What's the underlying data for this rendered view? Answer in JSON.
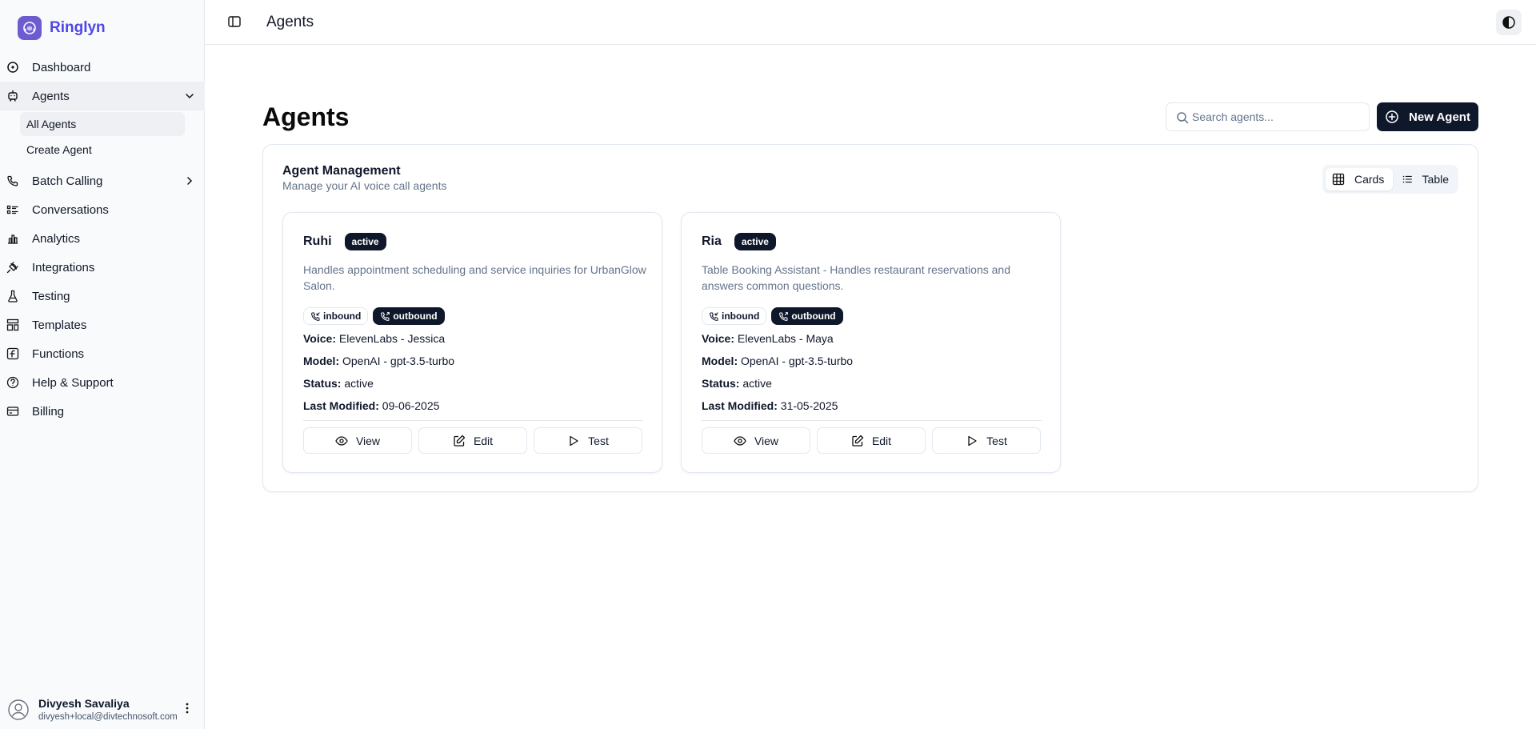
{
  "app": {
    "name": "Ringlyn"
  },
  "sidebar": {
    "items": [
      {
        "label": "Dashboard"
      },
      {
        "label": "Agents"
      },
      {
        "label": "Batch Calling"
      },
      {
        "label": "Conversations"
      },
      {
        "label": "Analytics"
      },
      {
        "label": "Integrations"
      },
      {
        "label": "Testing"
      },
      {
        "label": "Templates"
      },
      {
        "label": "Functions"
      },
      {
        "label": "Help & Support"
      },
      {
        "label": "Billing"
      }
    ],
    "agents_sub": [
      {
        "label": "All Agents"
      },
      {
        "label": "Create Agent"
      }
    ],
    "user": {
      "name": "Divyesh Savaliya",
      "email": "divyesh+local@divtechnosoft.com"
    }
  },
  "topbar": {
    "title": "Agents"
  },
  "main": {
    "title": "Agents",
    "search_placeholder": "Search agents...",
    "new_agent_label": "New Agent",
    "panel": {
      "title": "Agent Management",
      "subtitle": "Manage your AI voice call agents",
      "view_cards": "Cards",
      "view_table": "Table"
    },
    "labels": {
      "voice": "Voice:",
      "model": "Model:",
      "status": "Status:",
      "last_modified": "Last Modified:",
      "inbound": "inbound",
      "outbound": "outbound",
      "view": "View",
      "edit": "Edit",
      "test": "Test"
    },
    "agents": [
      {
        "name": "Ruhi",
        "badge": "active",
        "description": "Handles appointment scheduling and service inquiries for UrbanGlow Salon.",
        "voice": "ElevenLabs - Jessica",
        "model": "OpenAI - gpt-3.5-turbo",
        "status": "active",
        "last_modified": "09-06-2025"
      },
      {
        "name": "Ria",
        "badge": "active",
        "description": "Table Booking Assistant - Handles restaurant reservations and answers common questions.",
        "voice": "ElevenLabs - Maya",
        "model": "OpenAI - gpt-3.5-turbo",
        "status": "active",
        "last_modified": "31-05-2025"
      }
    ]
  },
  "colors": {
    "brand": "#4f46e5",
    "primary": "#0f172a",
    "muted": "#64748b",
    "sidebar_bg": "#f8fafc"
  }
}
